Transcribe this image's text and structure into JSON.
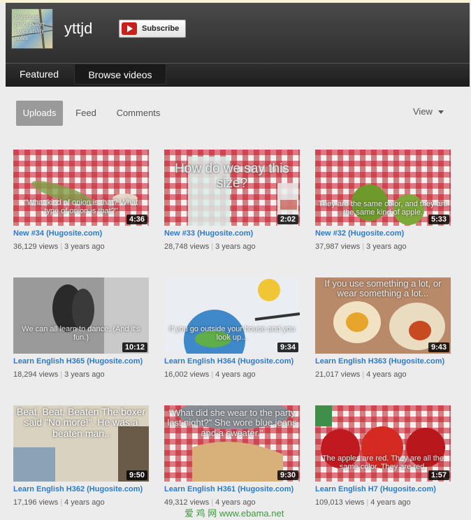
{
  "channel": {
    "name": "yttjd",
    "avatar_text": "telephone poles power poles utility poles",
    "subscribe_label": "Subscribe"
  },
  "channel_tabs": [
    {
      "label": "Featured"
    },
    {
      "label": "Browse videos"
    }
  ],
  "sub_tabs": [
    {
      "label": "Uploads"
    },
    {
      "label": "Feed"
    },
    {
      "label": "Comments"
    }
  ],
  "view_label": "View",
  "videos": [
    {
      "title": "New #34 (Hugosite.com)",
      "views": "36,129 views",
      "age": "3 years ago",
      "duration": "4:36",
      "overlay": "\"What kind of onion is that? What type of onion is that?\""
    },
    {
      "title": "New #33 (Hugosite.com)",
      "views": "28,748 views",
      "age": "3 years ago",
      "duration": "2:02",
      "overlay": "How do we say this size?"
    },
    {
      "title": "New #32 (Hugosite.com)",
      "views": "37,987 views",
      "age": "3 years ago",
      "duration": "5:33",
      "overlay": "They are the same color, and they are the same kind of apple."
    },
    {
      "title": "Learn English H365 (Hugosite.com)",
      "views": "18,294 views",
      "age": "3 years ago",
      "duration": "10:12",
      "overlay": "We can all learn to dance. (And it's fun.)"
    },
    {
      "title": "Learn English H364 (Hugosite.com)",
      "views": "16,002 views",
      "age": "4 years ago",
      "duration": "9:34",
      "overlay": "If you go outside your house and you look up..."
    },
    {
      "title": "Learn English H363 (Hugosite.com)",
      "views": "21,017 views",
      "age": "4 years ago",
      "duration": "9:43",
      "overlay": "If you use something a lot, or wear something a lot..."
    },
    {
      "title": "Learn English H362 (Hugosite.com)",
      "views": "17,196 views",
      "age": "4 years ago",
      "duration": "9:50",
      "overlay": "Beat, Beat, Beaten The boxer said \"No more!\". He was a beaten man.."
    },
    {
      "title": "Learn English H361 (Hugosite.com)",
      "views": "49,312 views",
      "age": "4 years ago",
      "duration": "9:30",
      "overlay": "\"What did she wear to the party last night?\" She wore blue jeans and a sweater.\""
    },
    {
      "title": "Learn English H7 (Hugosite.com)",
      "views": "109,013 views",
      "age": "4 years ago",
      "duration": "1:57",
      "overlay": "The apples are red. They are all the same color. They are red."
    }
  ],
  "watermark": "爱 鸡 网 www.ebama.net",
  "colors": {
    "link": "#2c7bc7",
    "header_bg": "#3a3a3a",
    "active_subtab": "#9a9a9a",
    "subscribe_icon": "#c8201d",
    "tablecloth": "#c41828"
  }
}
